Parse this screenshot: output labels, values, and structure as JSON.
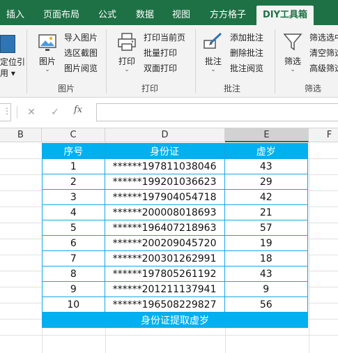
{
  "ribbon_tabs": [
    {
      "label": "插入",
      "active": false
    },
    {
      "label": "页面布局",
      "active": false
    },
    {
      "label": "公式",
      "active": false
    },
    {
      "label": "数据",
      "active": false
    },
    {
      "label": "视图",
      "active": false
    },
    {
      "label": "方方格子",
      "active": false
    },
    {
      "label": "DIY工具箱",
      "active": true
    }
  ],
  "ribbon": {
    "cut_left_label_1": "定位引",
    "cut_left_label_2": "用 ▾",
    "groups": {
      "picture": {
        "label": "图片",
        "big_button": "图片",
        "items": [
          "导入图片",
          "选区截图",
          "图片阅览"
        ]
      },
      "print": {
        "label": "打印",
        "big_button": "打印",
        "items": [
          "打印当前页",
          "批量打印",
          "双面打印"
        ]
      },
      "comment": {
        "label": "批注",
        "big_button": "批注",
        "items": [
          "添加批注",
          "删除批注",
          "批注阅览"
        ]
      },
      "filter": {
        "label": "筛选",
        "big_button": "筛选",
        "items": [
          "筛选选中",
          "清空筛选",
          "高级筛选"
        ]
      }
    }
  },
  "formula_bar": {
    "cancel_icon": "close-icon",
    "confirm_icon": "check-icon",
    "fx_label": "fx",
    "value": ""
  },
  "columns": [
    "B",
    "C",
    "D",
    "E",
    "F"
  ],
  "selected_column": "E",
  "table": {
    "headers": [
      "序号",
      "身份证",
      "虚岁"
    ],
    "rows": [
      [
        "1",
        "******197811038046",
        "43"
      ],
      [
        "2",
        "******199201036623",
        "29"
      ],
      [
        "3",
        "******197904054718",
        "42"
      ],
      [
        "4",
        "******200008018693",
        "21"
      ],
      [
        "5",
        "******196407218963",
        "57"
      ],
      [
        "6",
        "******200209045720",
        "19"
      ],
      [
        "7",
        "******200301262991",
        "18"
      ],
      [
        "8",
        "******197805261192",
        "43"
      ],
      [
        "9",
        "******201211137941",
        "9"
      ],
      [
        "10",
        "******196508229827",
        "56"
      ]
    ],
    "footer": "身份证提取虚岁"
  },
  "colors": {
    "excel_green": "#1e7145",
    "header_blue": "#00b0f0",
    "border_blue": "#17a5e6"
  }
}
